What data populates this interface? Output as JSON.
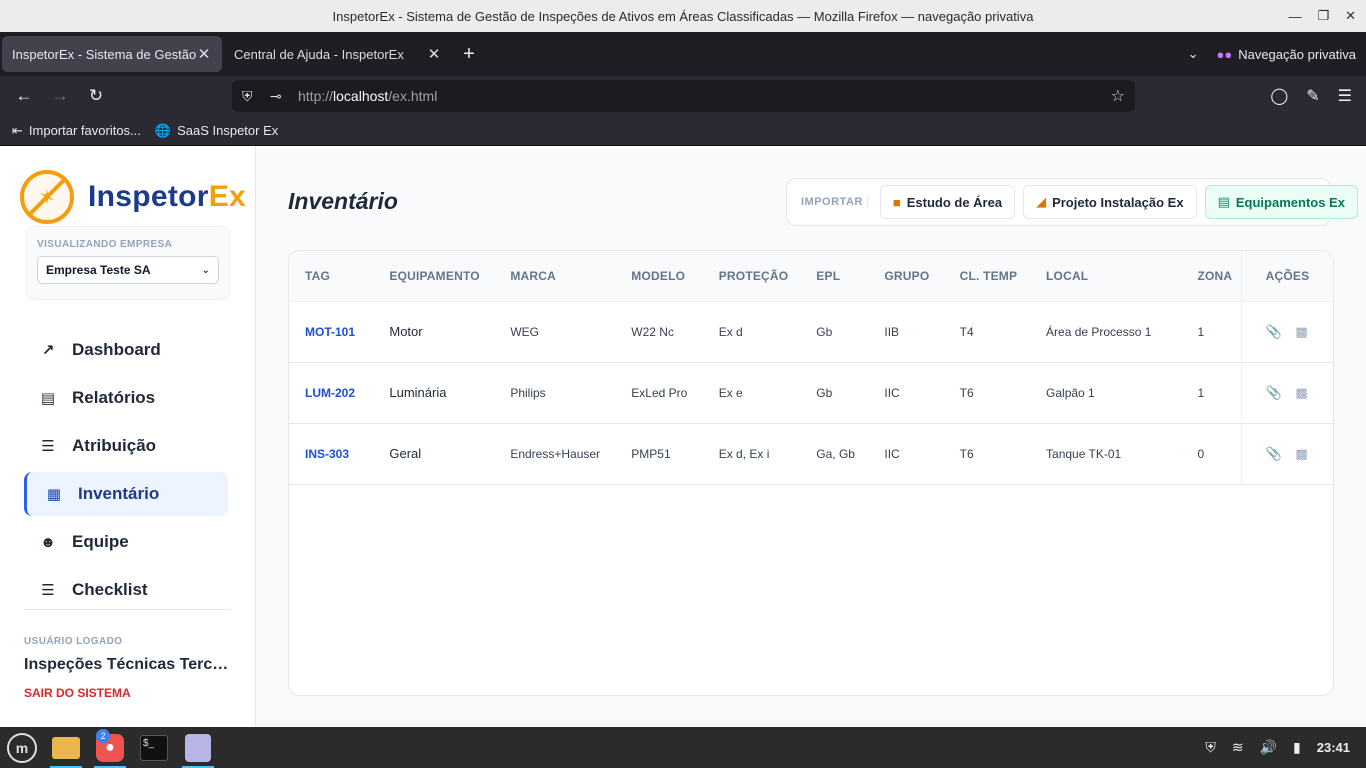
{
  "window": {
    "title": "InspetorEx - Sistema de Gestão de Inspeções de Ativos em Áreas Classificadas — Mozilla Firefox — navegação privativa"
  },
  "browser": {
    "tabs": [
      {
        "label": "InspetorEx - Sistema de Gestão d",
        "active": true
      },
      {
        "label": "Central de Ajuda - InspetorEx",
        "active": false
      }
    ],
    "private_label": "Navegação privativa",
    "url_prefix": "http://",
    "url_host": "localhost",
    "url_path": "/ex.html",
    "bookmarks": [
      {
        "label": "Importar favoritos...",
        "icon": "import-icon"
      },
      {
        "label": "SaaS Inspetor Ex",
        "icon": "globe-icon"
      }
    ]
  },
  "app": {
    "logo": {
      "text_main": "Inspetor",
      "text_accent": "Ex"
    },
    "company": {
      "label": "VISUALIZANDO EMPRESA",
      "selected": "Empresa Teste SA"
    },
    "menu": [
      {
        "label": "Dashboard",
        "icon": "chart-line-icon",
        "active": false
      },
      {
        "label": "Relatórios",
        "icon": "document-icon",
        "active": false
      },
      {
        "label": "Atribuição",
        "icon": "checklist-icon",
        "active": false
      },
      {
        "label": "Inventário",
        "icon": "boxes-icon",
        "active": true
      },
      {
        "label": "Equipe",
        "icon": "users-icon",
        "active": false
      },
      {
        "label": "Checklist",
        "icon": "checklist-icon",
        "active": false
      }
    ],
    "user": {
      "label": "USUÁRIO LOGADO",
      "name": "Inspeções Técnicas Terce...",
      "logout": "SAIR DO SISTEMA"
    }
  },
  "main": {
    "title": "Inventário",
    "import": {
      "label": "IMPORTAR",
      "buttons": [
        {
          "label": "Estudo de Área",
          "icon": "folder-icon"
        },
        {
          "label": "Projeto Instalação Ex",
          "icon": "ruler-icon"
        },
        {
          "label": "Equipamentos Ex",
          "icon": "spreadsheet-icon"
        }
      ]
    },
    "table": {
      "headers": [
        "TAG",
        "EQUIPAMENTO",
        "MARCA",
        "MODELO",
        "PROTEÇÃO",
        "EPL",
        "GRUPO",
        "CL. TEMP",
        "LOCAL",
        "ZONA",
        "AÇÕES"
      ],
      "rows": [
        {
          "tag": "MOT-101",
          "equipamento": "Motor",
          "marca": "WEG",
          "modelo": "W22 Nc",
          "protecao": "Ex d",
          "epl": "Gb",
          "grupo": "IIB",
          "cl_temp": "T4",
          "local": "Área de Processo 1",
          "zona": "1"
        },
        {
          "tag": "LUM-202",
          "equipamento": "Luminária",
          "marca": "Philips",
          "modelo": "ExLed Pro",
          "protecao": "Ex e",
          "epl": "Gb",
          "grupo": "IIC",
          "cl_temp": "T6",
          "local": "Galpão 1",
          "zona": "1"
        },
        {
          "tag": "INS-303",
          "equipamento": "Geral",
          "marca": "Endress+Hauser",
          "modelo": "PMP51",
          "protecao": "Ex d, Ex i",
          "epl": "Ga, Gb",
          "grupo": "IIC",
          "cl_temp": "T6",
          "local": "Tanque TK-01",
          "zona": "0"
        }
      ]
    }
  },
  "taskbar": {
    "clock": "23:41",
    "firefox_badge": "2"
  },
  "colors": {
    "brand_blue": "#1e3a8a",
    "brand_orange": "#f59e0b",
    "tag_link": "#1d4ed8",
    "logout_red": "#dc2626",
    "import_green": "#047857"
  }
}
